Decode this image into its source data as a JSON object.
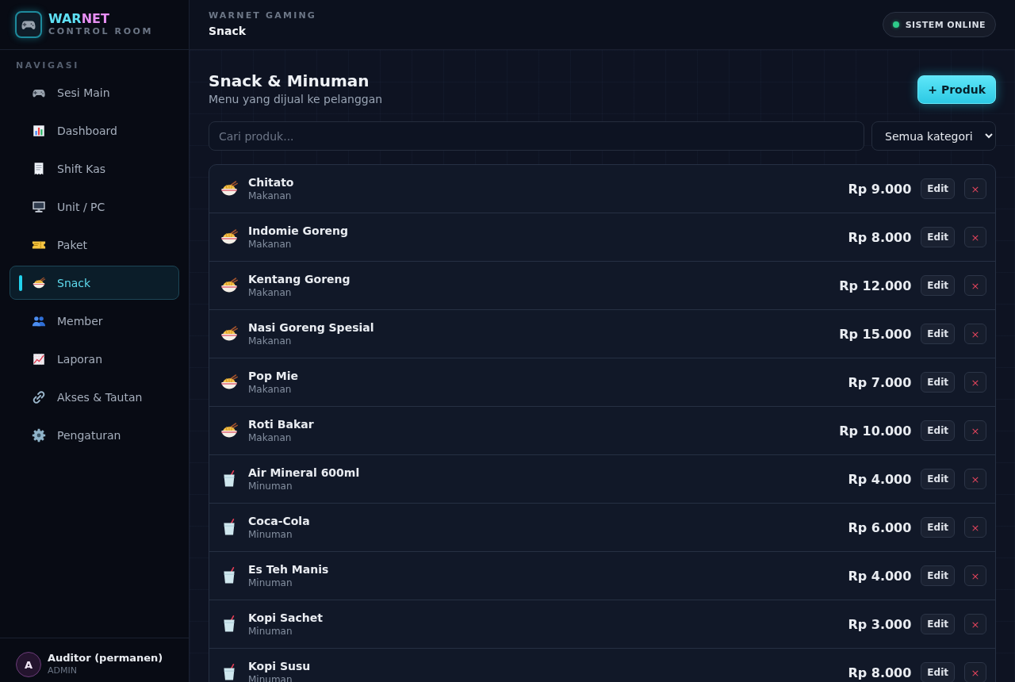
{
  "sidebar": {
    "logo": {
      "title_primary": "WAR",
      "title_accent": "NET",
      "subtitle": "CONTROL ROOM"
    },
    "section_label": "NAVIGASI",
    "items": [
      {
        "label": "Sesi Main",
        "selected": false
      },
      {
        "label": "Dashboard",
        "selected": false
      },
      {
        "label": "Shift Kas",
        "selected": false
      },
      {
        "label": "Unit / PC",
        "selected": false
      },
      {
        "label": "Paket",
        "selected": false
      },
      {
        "label": "Snack",
        "selected": true
      },
      {
        "label": "Member",
        "selected": false
      },
      {
        "label": "Laporan",
        "selected": false
      },
      {
        "label": "Akses & Tautan",
        "selected": false
      },
      {
        "label": "Pengaturan",
        "selected": false
      }
    ],
    "user": {
      "initial": "A",
      "name": "Auditor (permanen)",
      "role": "ADMIN"
    }
  },
  "topbar": {
    "eyebrow": "WARNET GAMING",
    "page_title": "Snack",
    "status": "SISTEM ONLINE"
  },
  "page": {
    "title": "Snack & Minuman",
    "subtitle": "Menu yang dijual ke pelanggan",
    "add_button": "+ Produk",
    "search": {
      "placeholder": "Cari produk..."
    },
    "category_filter": "Semua kategori"
  },
  "products": [
    {
      "kind": "food",
      "name": "Chitato",
      "category": "Makanan",
      "price": "Rp 9.000",
      "edit": "Edit",
      "delete": "×"
    },
    {
      "kind": "food",
      "name": "Indomie Goreng",
      "category": "Makanan",
      "price": "Rp 8.000",
      "edit": "Edit",
      "delete": "×"
    },
    {
      "kind": "food",
      "name": "Kentang Goreng",
      "category": "Makanan",
      "price": "Rp 12.000",
      "edit": "Edit",
      "delete": "×"
    },
    {
      "kind": "food",
      "name": "Nasi Goreng Spesial",
      "category": "Makanan",
      "price": "Rp 15.000",
      "edit": "Edit",
      "delete": "×"
    },
    {
      "kind": "food",
      "name": "Pop Mie",
      "category": "Makanan",
      "price": "Rp 7.000",
      "edit": "Edit",
      "delete": "×"
    },
    {
      "kind": "food",
      "name": "Roti Bakar",
      "category": "Makanan",
      "price": "Rp 10.000",
      "edit": "Edit",
      "delete": "×"
    },
    {
      "kind": "drink",
      "name": "Air Mineral 600ml",
      "category": "Minuman",
      "price": "Rp 4.000",
      "edit": "Edit",
      "delete": "×"
    },
    {
      "kind": "drink",
      "name": "Coca-Cola",
      "category": "Minuman",
      "price": "Rp 6.000",
      "edit": "Edit",
      "delete": "×"
    },
    {
      "kind": "drink",
      "name": "Es Teh Manis",
      "category": "Minuman",
      "price": "Rp 4.000",
      "edit": "Edit",
      "delete": "×"
    },
    {
      "kind": "drink",
      "name": "Kopi Sachet",
      "category": "Minuman",
      "price": "Rp 3.000",
      "edit": "Edit",
      "delete": "×"
    },
    {
      "kind": "drink",
      "name": "Kopi Susu",
      "category": "Minuman",
      "price": "Rp 8.000",
      "edit": "Edit",
      "delete": "×"
    }
  ]
}
